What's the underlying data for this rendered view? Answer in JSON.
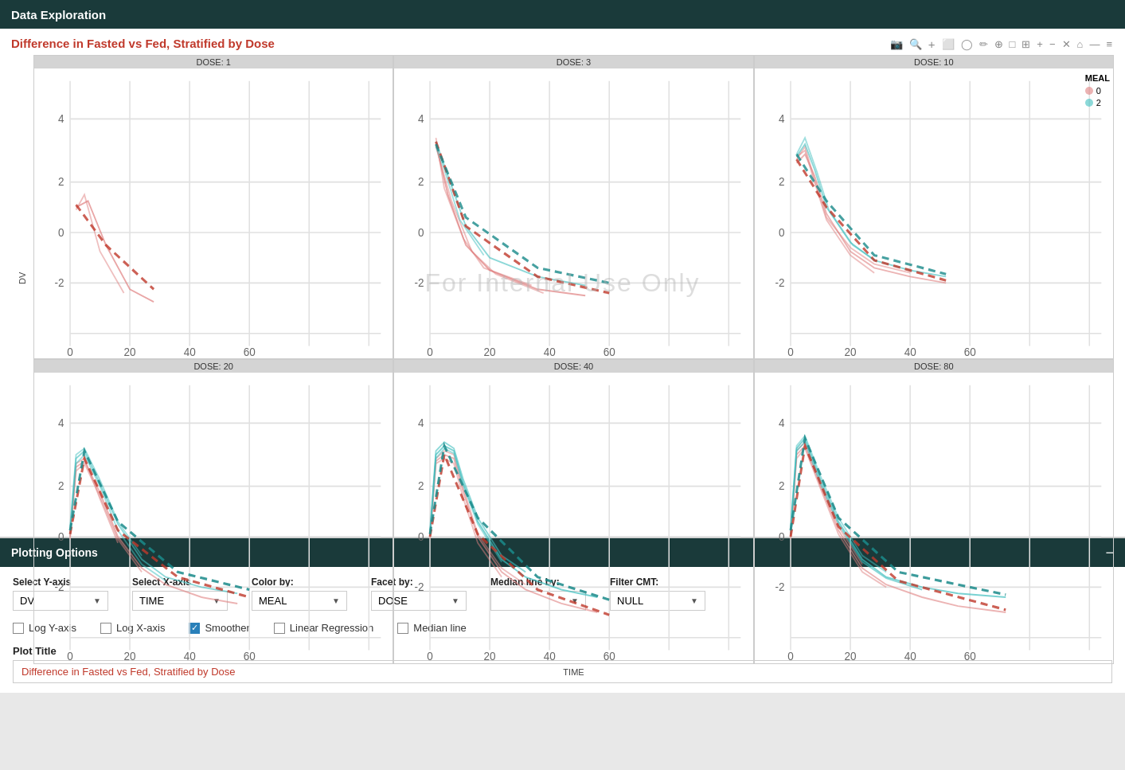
{
  "app": {
    "title": "Data Exploration"
  },
  "chart": {
    "title": "Difference in Fasted vs Fed, Stratified by Dose",
    "watermark": "For Internal Use Only",
    "y_axis_label": "DV",
    "x_axis_label": "TIME",
    "legend": {
      "title": "MEAL",
      "items": [
        {
          "label": "0",
          "color": "#e88080"
        },
        {
          "label": "2",
          "color": "#40bfbf"
        }
      ]
    },
    "facets": [
      {
        "label": "DOSE: 1"
      },
      {
        "label": "DOSE: 3"
      },
      {
        "label": "DOSE: 10"
      },
      {
        "label": "DOSE: 20"
      },
      {
        "label": "DOSE: 40"
      },
      {
        "label": "DOSE: 80"
      }
    ]
  },
  "toolbar": {
    "icons": [
      "📷",
      "🔍",
      "+",
      "⬛",
      "⚪",
      "✏️",
      "🔄",
      "□",
      "☐",
      "+",
      "−",
      "✕",
      "⌂",
      "—",
      "≡"
    ]
  },
  "plotting_options": {
    "header": "Plotting Options",
    "minimize_label": "−",
    "selects": [
      {
        "label": "Select Y-axis",
        "value": "DV"
      },
      {
        "label": "Select X-axis",
        "value": "TIME"
      },
      {
        "label": "Color by:",
        "value": "MEAL"
      },
      {
        "label": "Facet by:",
        "value": "DOSE"
      },
      {
        "label": "Median line by:",
        "value": ""
      },
      {
        "label": "Filter CMT:",
        "value": "NULL"
      }
    ],
    "checkboxes": [
      {
        "label": "Log Y-axis",
        "checked": false
      },
      {
        "label": "Log X-axis",
        "checked": false
      },
      {
        "label": "Smoother",
        "checked": true
      },
      {
        "label": "Linear Regression",
        "checked": false
      },
      {
        "label": "Median line",
        "checked": false
      }
    ],
    "plot_title_label": "Plot Title",
    "plot_title_value": "Difference in Fasted vs Fed, Stratified by Dose"
  }
}
